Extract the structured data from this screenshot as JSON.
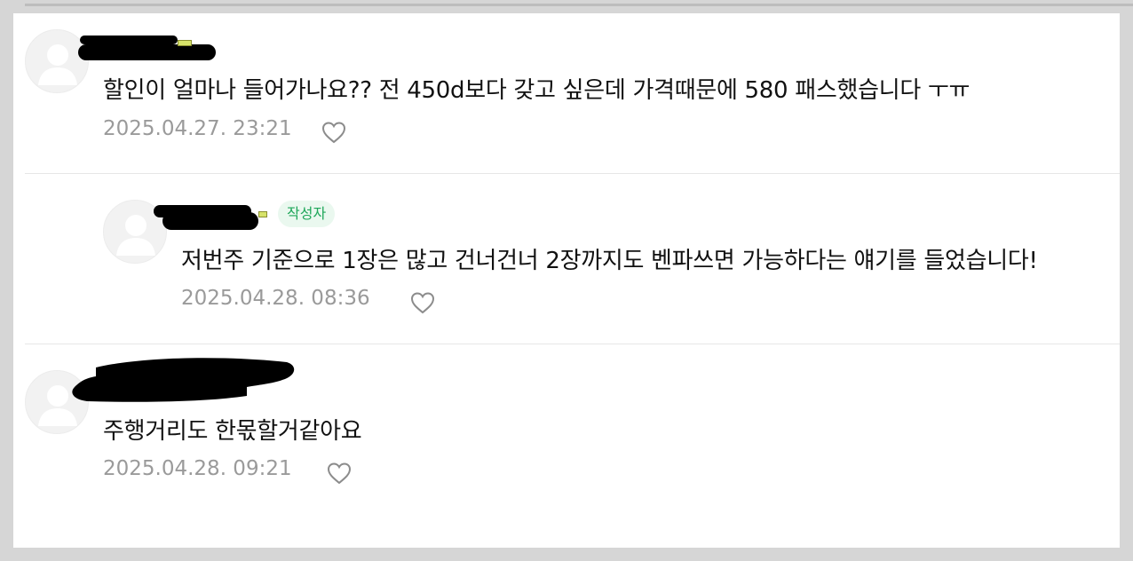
{
  "comments": [
    {
      "text": "할인이 얼마나 들어가나요?? 전 450d보다 갖고 싶은데 가격때문에 580 패스했습니다 ㅜㅠ",
      "date": "2025.04.27. 23:21",
      "is_reply": false
    },
    {
      "badge": "작성자",
      "text": "저번주 기준으로 1장은 많고 건너건너 2장까지도 벤파쓰면 가능하다는 얘기를 들었습니다!",
      "date": "2025.04.28. 08:36",
      "is_reply": true
    },
    {
      "text": "주행거리도 한몫할거같아요",
      "date": "2025.04.28. 09:21",
      "is_reply": false
    }
  ],
  "icons": {
    "like": "heart-outline-icon",
    "avatar": "default-user-avatar-icon"
  },
  "colors": {
    "badge_text": "#1fa75a",
    "badge_bg": "#eaf8ef",
    "date_text": "#9a9a9a"
  }
}
